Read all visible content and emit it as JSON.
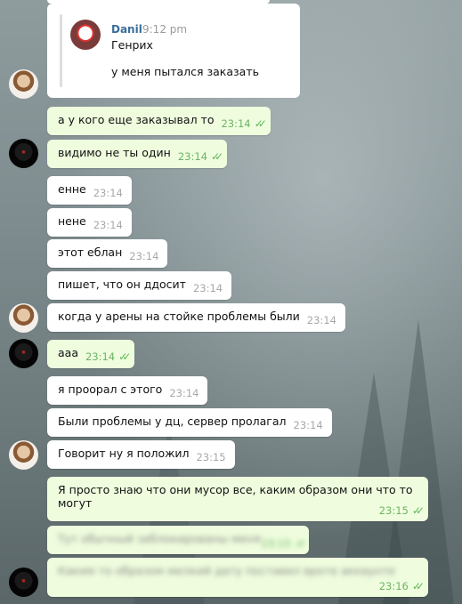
{
  "quoted": {
    "author": "Danil",
    "time": "9:12 pm",
    "line1": "Генрих",
    "line2": "у меня пытался заказать"
  },
  "messages": [
    {
      "text": "а у кого еще заказывал то",
      "time": "23:14",
      "out": true
    },
    {
      "text": "видимо не ты один",
      "time": "23:14",
      "out": true
    },
    {
      "text": "енне",
      "time": "23:14",
      "out": false
    },
    {
      "text": "нене",
      "time": "23:14",
      "out": false
    },
    {
      "text": "этот еблан",
      "time": "23:14",
      "out": false
    },
    {
      "text": "пишет, что он ддосит",
      "time": "23:14",
      "out": false
    },
    {
      "text": "когда у арены на стойке проблемы были",
      "time": "23:14",
      "out": false
    },
    {
      "text": "ааа",
      "time": "23:14",
      "out": true
    },
    {
      "text": "я проорал с этого",
      "time": "23:14",
      "out": false
    },
    {
      "text": "Были проблемы у дц, сервер пролагал",
      "time": "23:14",
      "out": false
    },
    {
      "text": "Говорит ну я положил",
      "time": "23:15",
      "out": false
    },
    {
      "text_line1": "Я просто знаю что они мусор все, каким образом они что то",
      "text_line2": "могут",
      "time": "23:15",
      "out": true
    },
    {
      "text": "Тут обычный заблокированы меня",
      "time": "23:15",
      "out": true,
      "blurred": true
    },
    {
      "text": "Каким то образом мелкий дату поставил вроте аккаунте",
      "time": "23:16",
      "out": true,
      "blurred": true
    }
  ],
  "icons": {
    "read": "double-check-icon"
  },
  "colors": {
    "outgoing": "#effdde",
    "incoming": "#ffffff",
    "time_out": "#6cb364",
    "author": "#3a6d99"
  }
}
